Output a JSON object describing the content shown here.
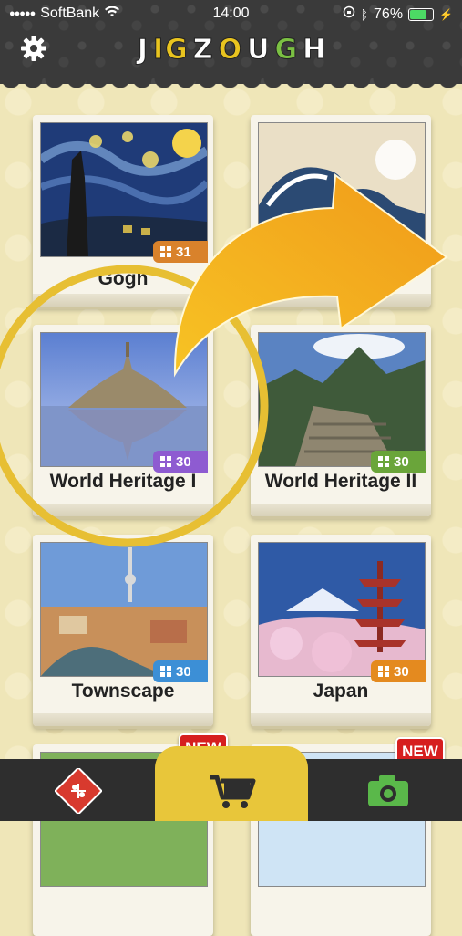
{
  "status_bar": {
    "carrier": "SoftBank",
    "time": "14:00",
    "battery": "76%",
    "battery_level": 0.76
  },
  "header": {
    "logo_letters": [
      "J",
      "IG",
      "Z",
      "O",
      "U",
      "G",
      "H"
    ],
    "settings_icon": "gear-icon"
  },
  "cards": [
    {
      "title": "Gogh",
      "count": "31",
      "badge_color": "#d9822b",
      "new": false
    },
    {
      "title": "",
      "count": "",
      "badge_color": "#d61f1f",
      "new": false
    },
    {
      "title": "World Heritage I",
      "count": "30",
      "badge_color": "#8e5bd1",
      "new": false
    },
    {
      "title": "World Heritage II",
      "count": "30",
      "badge_color": "#6aa53a",
      "new": false
    },
    {
      "title": "Townscape",
      "count": "30",
      "badge_color": "#3c8fd6",
      "new": false
    },
    {
      "title": "Japan",
      "count": "30",
      "badge_color": "#e48a1f",
      "new": false
    },
    {
      "title": "",
      "count": "",
      "badge_color": "",
      "new": true,
      "new_label": "NEW"
    },
    {
      "title": "",
      "count": "",
      "badge_color": "",
      "new": true,
      "new_label": "NEW"
    }
  ],
  "tabbar": {
    "left_icon": "puzzle-icon",
    "center_icon": "shop-cart-icon",
    "right_icon": "camera-icon"
  },
  "colors": {
    "accent": "#e8c63a",
    "arrow": "#f3b51c",
    "header_bg": "#3a3a3a",
    "page_bg": "#efe6b8"
  }
}
